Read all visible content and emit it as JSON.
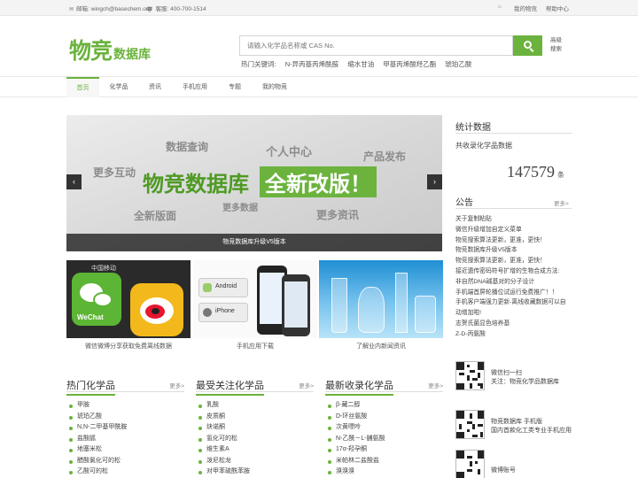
{
  "topbar": {
    "email": "邮箱: wingch@basechem.org",
    "phone": "客服: 400-700-1514",
    "my_wujing": "我的物竞",
    "help_center": "帮助中心"
  },
  "logo": {
    "big": "物竞",
    "small": "数据库"
  },
  "search": {
    "placeholder": "请输入化学品名称或 CAS No.",
    "advanced": "高级搜索",
    "hot_label": "热门关键词:",
    "hot_keywords": [
      "N-异丙基丙烯酰胺",
      "缩水甘油",
      "甲基丙烯酸羟乙酯",
      "琥珀乙酸"
    ]
  },
  "nav": [
    "首页",
    "化学品",
    "资讯",
    "手机应用",
    "专题",
    "我的物竞"
  ],
  "banner": {
    "words": [
      "数据查询",
      "个人中心",
      "产品发布",
      "更多互动",
      "全新版面",
      "更多数据",
      "更多资讯"
    ],
    "headline_a": "物竞数据库",
    "headline_b": "全新改版！",
    "caption": "物竞数据库升级V5版本",
    "prev": "‹",
    "next": "›"
  },
  "thumbs": [
    {
      "caption": "微信微博分享获取免费离线数据",
      "img_text_a": "中国移动",
      "img_text_b": "WeChat"
    },
    {
      "caption": "手机应用下载",
      "img_text_a": "Android",
      "img_text_b": "iPhone"
    },
    {
      "caption": "了解业内新闻资讯"
    }
  ],
  "columns": [
    {
      "title": "热门化学品",
      "more": "更多>",
      "items": [
        "甲胺",
        "琥珀乙酸",
        "N,N-二甲基甲酰胺",
        "盐酸胍",
        "地塞米松",
        "醋酸氯化可的松",
        "乙酸可的松"
      ]
    },
    {
      "title": "最受关注化学品",
      "more": "更多>",
      "items": [
        "乳酸",
        "皮质酮",
        "炔诺酮",
        "氢化可的松",
        "维生素A",
        "泼尼松龙",
        "对甲苯硫酰苯胺"
      ]
    },
    {
      "title": "最新收录化学品",
      "more": "更多>",
      "items": [
        "β-藏二醇",
        "D-环丝氨酸",
        "次黄嘌呤",
        "N-乙酰－L-脯氨酸",
        "17α-羟孕酮",
        "米帕林二盐酸盐",
        "溴溴溴"
      ]
    }
  ],
  "sidebar": {
    "stats_title": "统计数据",
    "stats_label": "共收录化学品数据",
    "stats_count": "147579",
    "stats_unit": "条",
    "notice_title": "公告",
    "notice_more": "更多>",
    "notices": [
      "关于复制粘贴",
      "微信升级增加自定义菜单",
      "物竞搜索算法更新，更准，更快！",
      "物竞数据库升级V5版本",
      "物竞搜索算法更新，更准，更快！",
      "接近遗传密码符号扩增的生物合成方法:",
      "非自然DNA碱基对的分子设计",
      "手机端首屏轮播位试运行免费推广！！",
      "手机客户端强力更新-离线收藏数据可以自",
      "动增加啦!",
      "志贺氏菌显色培养基",
      "Z-D-丙氨酸"
    ],
    "qrs": [
      {
        "line1": "微信扫一扫",
        "line2": "关注：物竞化学品数据库"
      },
      {
        "line1": "物竞数据库 手机版",
        "line2": "国内首款化工类专业手机应用"
      },
      {
        "line1": "微博账号",
        "line2": ""
      }
    ]
  }
}
